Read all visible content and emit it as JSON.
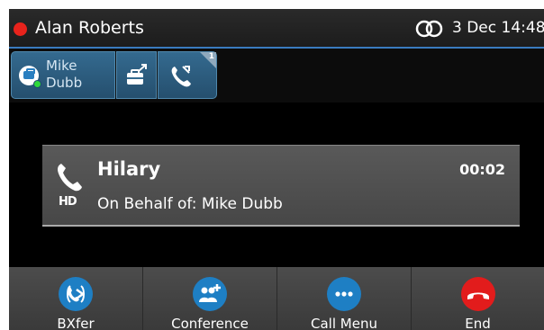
{
  "status_bar": {
    "user_name": "Alan Roberts",
    "datetime": "3 Dec 14:48",
    "status_color": "#e8231c"
  },
  "line_keys": [
    {
      "label": "Mike Dubb",
      "icon": "contact-icon",
      "presence": "available"
    },
    {
      "icon": "transfer-icon"
    },
    {
      "icon": "phone-icon",
      "badge": "1"
    }
  ],
  "call": {
    "caller": "Hilary",
    "timer": "00:02",
    "on_behalf": "On Behalf of: Mike Dubb",
    "hd_label": "HD"
  },
  "softkeys": [
    {
      "label": "BXfer",
      "icon": "blind-transfer-icon",
      "color": "#1e7fc4"
    },
    {
      "label": "Conference",
      "icon": "conference-icon",
      "color": "#1e7fc4"
    },
    {
      "label": "Call Menu",
      "icon": "more-icon",
      "color": "#1e7fc4"
    },
    {
      "label": "End",
      "icon": "hangup-icon",
      "color": "#e21c1c"
    }
  ]
}
